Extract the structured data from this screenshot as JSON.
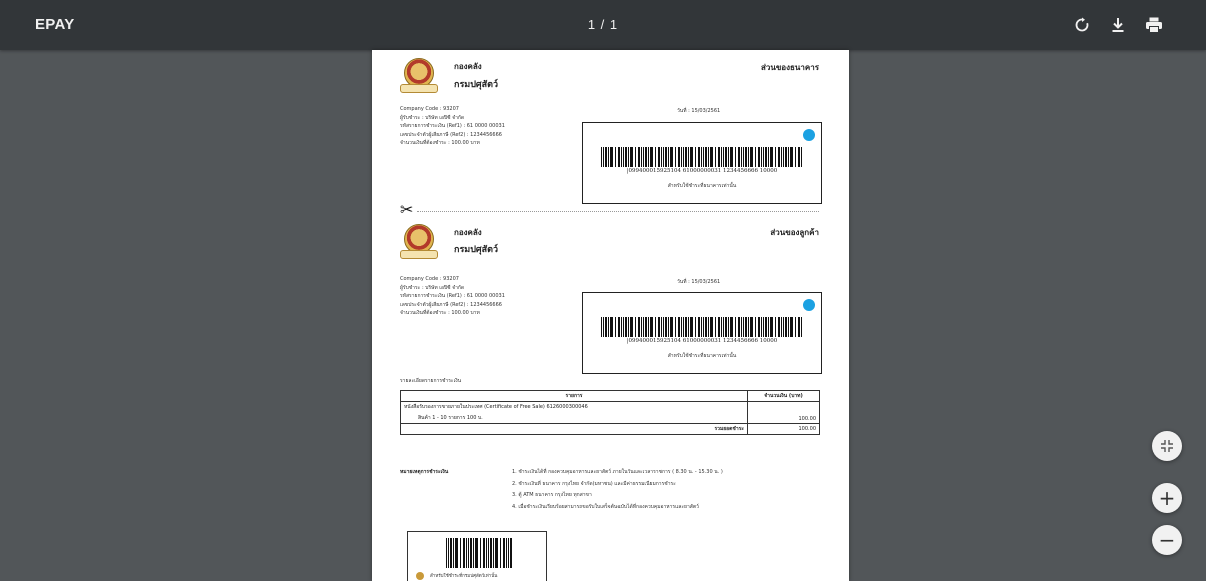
{
  "toolbar": {
    "title": "EPAY",
    "page_indicator": "1 / 1",
    "buttons": [
      {
        "name": "rotate",
        "icon": "rotate-icon"
      },
      {
        "name": "download",
        "icon": "download-icon"
      },
      {
        "name": "print",
        "icon": "print-icon"
      }
    ]
  },
  "document": {
    "org_line1": "กองคลัง",
    "org_line2": "กรมปศุสัตว์",
    "bank_part_title": "ส่วนของธนาคาร",
    "customer_part_title": "ส่วนของลูกค้า",
    "info_lines": [
      "Company Code :  93207",
      "ผู้รับชำระ :   บริษัท เอปิซี จำกัด",
      "รหัสรายการชำระเงิน (Ref1) :  61 0000 00031",
      "เลขประจำตัวผู้เสียภาษี (Ref2) :  1234456666",
      "จำนวนเงินที่ต้องชำระ :   100.00 บาท"
    ],
    "date_label": "วันที่ : 15/03/2561",
    "barcode_text": "|099400015925104 61000000031 1234456666 10000",
    "barcode_note": "สำหรับใช้ชำระที่ธนาคารเท่านั้น",
    "scissors_glyph": "✂",
    "details_title": "รายละเอียดรายการชำระเงิน",
    "table": {
      "headers": [
        "รายการ",
        "จำนวนเงิน (บาท)"
      ],
      "item_line1": "หนังสือรับรองการขายภายในประเทศ (Certificate of Free Sale)  6126000300046",
      "item_line2": "สินค้า 1 - 10 รายการ 100 บ.",
      "item_amount": "100.00",
      "total_label": "รวมยอดชำระ",
      "total_amount": "100.00"
    },
    "notes_label": "หมายเหตุการชำระเงิน",
    "notes": [
      "1. ชำระเงินได้ที่ กองควบคุมอาหารและยาสัตว์ ภายในวันและเวลาราชการ ( 8.30 น. - 15.30 น. )",
      "2. ชำระเงินที่ ธนาคาร กรุงไทย จำกัด(มหาชน) และมีค่าธรรมเนียมการชำระ",
      "3. ตู้ ATM ธนาคาร กรุงไทย ทุกสาขา",
      "4. เมื่อชำระเงินเรียบร้อยสามารถขอรับใบเสร็จต้นฉบับได้ที่กองควบคุมอาหารและยาสัตว์"
    ],
    "stub_note": "สำหรับใช้ชำระที่กรมปศุสัตว์เท่านั้น"
  },
  "zoom_controls": {
    "fit_icon": "fit-page-icon",
    "zoom_in": "+",
    "zoom_out": "−"
  }
}
